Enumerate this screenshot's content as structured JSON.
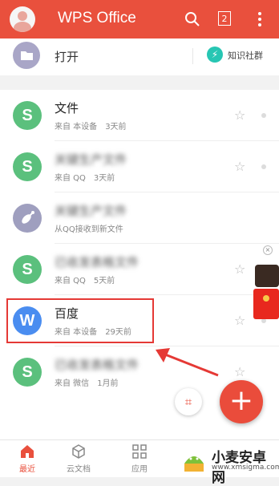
{
  "header": {
    "title": "WPS Office",
    "tab_count": "2"
  },
  "open_row": {
    "label": "打开",
    "community_label": "知识社群"
  },
  "files": [
    {
      "icon": "S",
      "icon_color": "#5bc07d",
      "title": "文件",
      "source": "来自 本设备",
      "time": "3天前",
      "blurred": false
    },
    {
      "icon": "S",
      "icon_color": "#5bc07d",
      "title": "关键生产文件",
      "source": "来自 QQ",
      "time": "3天前",
      "blurred": true
    },
    {
      "icon": "S",
      "icon_color": "#9f9fbf",
      "title": "关键生产文件",
      "source": "从QQ接收到新文件",
      "time": "",
      "blurred": true
    },
    {
      "icon": "S",
      "icon_color": "#5bc07d",
      "title": "已收发表格文件",
      "source": "来自 QQ",
      "time": "5天前",
      "blurred": true
    },
    {
      "icon": "W",
      "icon_color": "#4a8df0",
      "title": "百度",
      "source": "来自 本设备",
      "time": "29天前",
      "blurred": false
    },
    {
      "icon": "S",
      "icon_color": "#5bc07d",
      "title": "已收发表格文件",
      "source": "来自 微信",
      "time": "1月前",
      "blurred": true
    }
  ],
  "bottom_nav": [
    {
      "label": "最近",
      "active": true
    },
    {
      "label": "云文档",
      "active": false
    },
    {
      "label": "应用",
      "active": false
    }
  ],
  "watermark": {
    "title": "小麦安卓网",
    "url": "www.xmsigma.com"
  },
  "colors": {
    "accent": "#e9503d",
    "highlight_box": "#e53935"
  }
}
